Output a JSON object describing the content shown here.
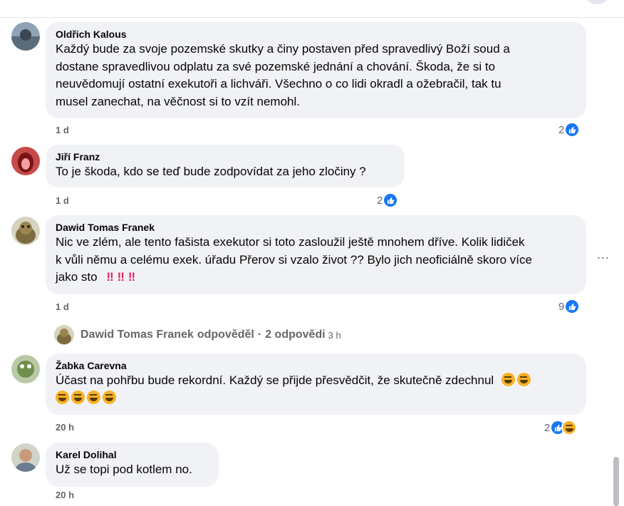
{
  "comments": [
    {
      "author": "Oldřich Kalous",
      "lines": [
        "Každý bude za svoje pozemské skutky a činy postaven před spravedlivý Boží soud a",
        "dostane spravedlivou odplatu za své pozemské jednání a chování. Škoda, že si to",
        "neuvědomují ostatní exekutoři a lichváři. Všechno o co lidi okradl a ožebračil, tak tu",
        "musel zanechat, na věčnost si to vzít nemohl."
      ],
      "time": "1 d",
      "reaction_count": "2",
      "reactions": [
        "like-icon"
      ]
    },
    {
      "author": "Jiří Franz",
      "lines": [
        "To je škoda, kdo se teď bude zodpovídat za jeho zločiny ?"
      ],
      "time": "1 d",
      "reaction_count": "2",
      "reactions": [
        "like-icon"
      ]
    },
    {
      "author": "Dawid Tomas Franek",
      "lines": [
        "Nic ve zlém, ale tento fašista exekutor si toto zasloužil ještě mnohem dříve. Kolik lidiček",
        "k vůli němu a celému exek. úřadu Přerov si vzalo život ?? Bylo jich neoficiálně skoro více",
        "jako sto"
      ],
      "emoji_tail": [
        "‼",
        "‼",
        "‼"
      ],
      "time": "1 d",
      "reaction_count": "9",
      "reactions": [
        "like-icon"
      ]
    },
    {
      "author": "Žabka Carevna",
      "lines": [
        "Účast na pohřbu bude rekordní. Každý se přijde přesvědčit, že skutečně zdechnul"
      ],
      "emoji_line": [
        "😂",
        "😂",
        "😂",
        "😂"
      ],
      "time": "20 h",
      "reaction_count": "2",
      "reactions": [
        "like-icon",
        "haha-icon"
      ]
    },
    {
      "author": "Karel Dolihal",
      "lines": [
        "Už se topi pod kotlem no."
      ],
      "time": "20 h"
    }
  ],
  "reply_summary": {
    "author": "Dawid Tomas Franek",
    "action": "odpověděl",
    "separator": "·",
    "count": "2 odpovědi",
    "time": "3 h"
  },
  "more_menu": "...",
  "colors": {
    "bubble": "#f0f2f5",
    "like": "#1877f2",
    "meta": "#65676b",
    "haha": "#f7b125"
  }
}
